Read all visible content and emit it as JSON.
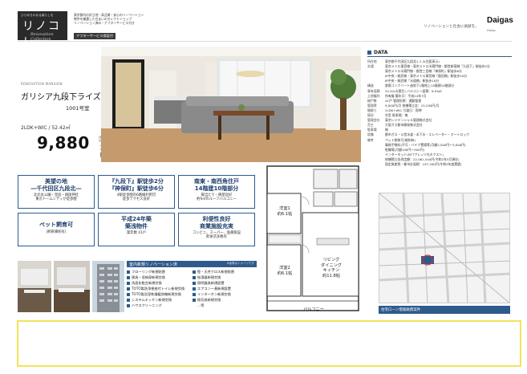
{
  "header": {
    "logo_tag": "ひらめきのある暮らしを",
    "logo_main": "リノコレ",
    "logo_sub": "Renovation Collection",
    "description_lines": [
      "東京都内の好立地・高品質・安心のリノベーション",
      "物件を厳選した住まいのセレクトショップ",
      "リノベーション済み・アフターサービス付き"
    ],
    "badge": "アフターサービス保証付",
    "right_text": "リノベーションと社会に貢献を。",
    "brand": "Daigas",
    "brand_sub": "Group"
  },
  "property": {
    "name_en": "RENOVATION MANSION",
    "name": "ガリシア九段下ライズ",
    "room": "1001号室",
    "layout": "2LDK+WIC / 52.42㎡",
    "price": "9,880",
    "price_note": "(税込)",
    "price_unit": "万円"
  },
  "features": [
    {
      "title": "美望の地\n―千代田区九段北―",
      "sub": "北の丸公園・皇居・靖国神社\n東京ドームシティが徒歩圏"
    },
    {
      "title": "『九段下』駅徒歩2分\n『神保町』駅徒歩6分",
      "sub": "4駅徒歩圏内6路線利用可\n徒歩アクセス良好"
    },
    {
      "title": "南東・南西角住戸\n14階建10階部分",
      "sub": "陽当たり・眺望良好\n約9㎡のルーフバルコニー"
    },
    {
      "title": "ペット飼育可",
      "sub": "(飼育細則有)"
    },
    {
      "title": "平成24年築\n築浅物件",
      "sub": "築年数 41戸"
    },
    {
      "title": "利便性良好\n商業施設充実",
      "sub": "コンビニ、スーパー、医療施設\n飲食店多数有"
    }
  ],
  "renovation": {
    "title": "室内新規リノベーション済",
    "note": "※画像はイメージです",
    "left": [
      "フローリング新規貼替",
      "建具・収納扉新規交換",
      "洗面化粧台新規交換",
      "TOTO製洗浄便座付トイレ新規交換",
      "TOTO製浴室乾燥暖房機新規交換",
      "システムキッチン新規交換",
      "ハウスクリーニング"
    ],
    "right": [
      "壁・天井クロス新規貼替",
      "給湯器新規交換",
      "照明器具新規設置",
      "エアコン一基新規設置",
      "インターホン新規交換",
      "換気扇新規交換",
      "…等"
    ]
  },
  "floorplan": {
    "rooms": [
      {
        "name": "洋室1\n約6.1帖"
      },
      {
        "name": "洋室2\n約6.1帖"
      },
      {
        "name": "リビング\nダイニング\nキッチン\n約11.8帖"
      },
      {
        "name": "バルコニー"
      }
    ]
  },
  "data": {
    "title": "DATA",
    "rows": [
      {
        "k": "所在地",
        "v": "東京都千代田区九段北1-7-3(住居表示)"
      },
      {
        "k": "交通",
        "v": "東京メトロ東西線・東京メトロ半蔵門線・都営新宿線「九段下」駅徒歩2分"
      },
      {
        "k": "",
        "v": "東京メトロ半蔵門線・都営三田線「神保町」駅徒歩6分"
      },
      {
        "k": "",
        "v": "JR中央・総武線・東京メトロ東西線「飯田橋」駅徒歩10分"
      },
      {
        "k": "",
        "v": "JR中央・総武線「水道橋」駅徒歩10分"
      },
      {
        "k": "構造",
        "v": "鉄筋コンクリート造地下1階地上14階建10階部分"
      },
      {
        "k": "専有面積",
        "v": "52.42㎡(壁芯)    バルコニー面積：8.94㎡"
      },
      {
        "k": "土地権利",
        "v": "所有権    築年月：平成24年7月"
      },
      {
        "k": "総戸数",
        "v": "41戸    管理形態：通勤管理"
      },
      {
        "k": "管理費",
        "v": "9,000円/月    修繕積立金：15,290円/月"
      },
      {
        "k": "間取り",
        "v": "2LDK+WIC    引渡日：即時"
      },
      {
        "k": "現況",
        "v": "空室    駐車場：無"
      },
      {
        "k": "管理会社",
        "v": "東京レジデンシャル管理株式会社"
      },
      {
        "k": "売主",
        "v": "大阪ガス都市開発株式会社"
      },
      {
        "k": "駐車場",
        "v": "無"
      },
      {
        "k": "設備",
        "v": "都市ガス・公営水道・本下水・エレベーター・オートロック"
      },
      {
        "k": "備考",
        "v": "ペット飼育可(細則有)"
      },
      {
        "k": "",
        "v": "事務手数料(不可・バイク置場等(月額2,500円～3,000円)"
      },
      {
        "k": "",
        "v": "駐輪場(月額100円～300円)"
      },
      {
        "k": "",
        "v": "インターネット(NTTフレッツ光ネクスト)"
      },
      {
        "k": "",
        "v": "修繕積立金改定額：22,061,544円(令和2年3月現在)"
      },
      {
        "k": "",
        "v": "固定資産税・都市計画税：197,200円(令和5年度実績)"
      }
    ],
    "map_caption": "住宅ローン借換融資案件"
  }
}
